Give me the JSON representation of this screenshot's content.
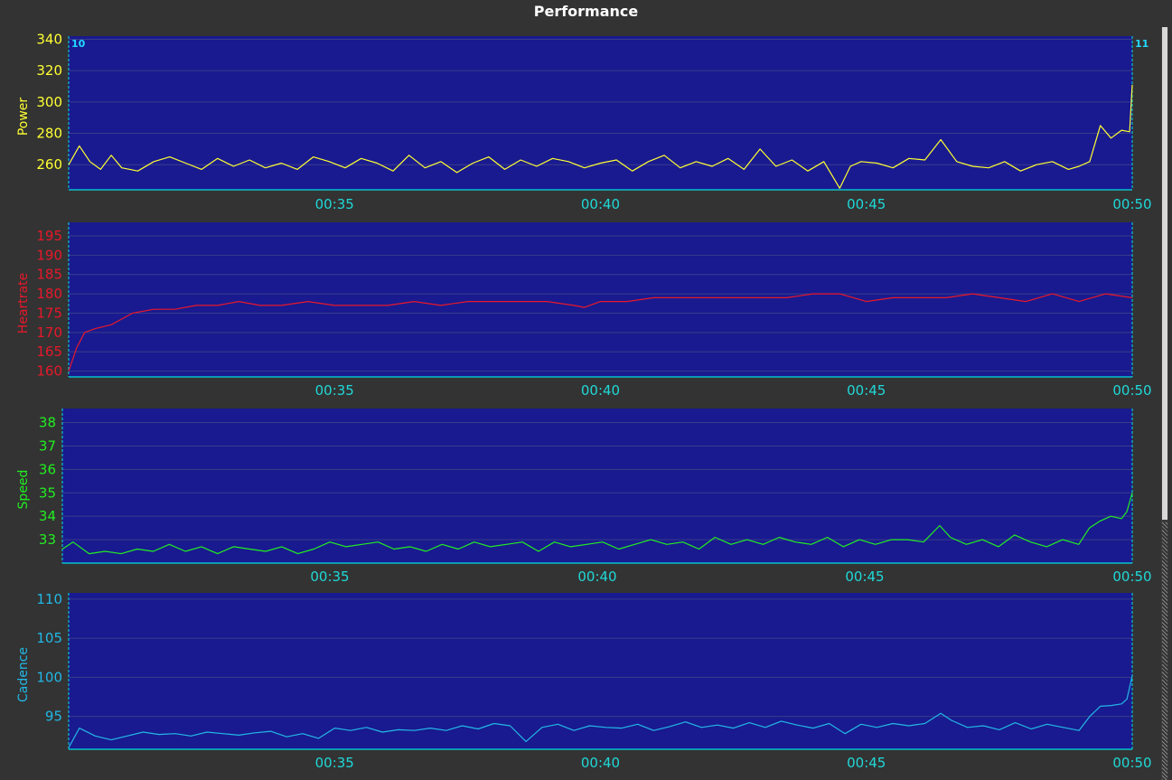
{
  "title": "Performance",
  "interval_markers": {
    "start": "10",
    "end": "11"
  },
  "colors": {
    "background": "#333333",
    "plot_bg": "#191a8f",
    "grid": "#3a3d8a",
    "axis": "#00e0e0",
    "tick_x": "#20d8d8",
    "power": "#ffff33",
    "heartrate": "#e8182a",
    "speed": "#22ee22",
    "cadence": "#22b8e6"
  },
  "chart_data": [
    {
      "type": "line",
      "ylabel": "Power",
      "ylim": [
        244,
        342
      ],
      "yticks": [
        340,
        320,
        300,
        280,
        260
      ],
      "xlim": [
        30.0,
        50.0
      ],
      "xticks": [
        "00:35",
        "00:40",
        "00:45",
        "00:50"
      ],
      "xtick_values": [
        35,
        40,
        45,
        50
      ],
      "grid": true,
      "color_key": "power",
      "series": [
        {
          "x": [
            30.0,
            30.2,
            30.4,
            30.6,
            30.8,
            31.0,
            31.3,
            31.6,
            31.9,
            32.2,
            32.5,
            32.8,
            33.1,
            33.4,
            33.7,
            34.0,
            34.3,
            34.6,
            34.9,
            35.2,
            35.5,
            35.8,
            36.1,
            36.4,
            36.7,
            37.0,
            37.3,
            37.6,
            37.9,
            38.2,
            38.5,
            38.8,
            39.1,
            39.4,
            39.7,
            40.0,
            40.3,
            40.6,
            40.9,
            41.2,
            41.5,
            41.8,
            42.1,
            42.4,
            42.7,
            43.0,
            43.3,
            43.6,
            43.9,
            44.2,
            44.5,
            44.7,
            44.9,
            45.2,
            45.5,
            45.8,
            46.1,
            46.4,
            46.7,
            47.0,
            47.3,
            47.6,
            47.9,
            48.2,
            48.5,
            48.8,
            49.0,
            49.2,
            49.4,
            49.6,
            49.8,
            49.95,
            50.0
          ],
          "y": [
            260,
            272,
            262,
            257,
            266,
            258,
            256,
            262,
            265,
            261,
            257,
            264,
            259,
            263,
            258,
            261,
            257,
            265,
            262,
            258,
            264,
            261,
            256,
            266,
            258,
            262,
            255,
            261,
            265,
            257,
            263,
            259,
            264,
            262,
            258,
            261,
            263,
            256,
            262,
            266,
            258,
            262,
            259,
            264,
            257,
            270,
            259,
            263,
            256,
            262,
            245,
            259,
            262,
            261,
            258,
            264,
            263,
            276,
            262,
            259,
            258,
            262,
            256,
            260,
            262,
            257,
            259,
            262,
            285,
            277,
            282,
            281,
            311
          ]
        }
      ]
    },
    {
      "type": "line",
      "ylabel": "Heartrate",
      "ylim": [
        158.5,
        198.5
      ],
      "yticks": [
        195,
        190,
        185,
        180,
        175,
        170,
        165,
        160
      ],
      "xlim": [
        30.0,
        50.0
      ],
      "xticks": [
        "00:35",
        "00:40",
        "00:45",
        "00:50"
      ],
      "xtick_values": [
        35,
        40,
        45,
        50
      ],
      "grid": true,
      "color_key": "heartrate",
      "series": [
        {
          "x": [
            30.0,
            30.15,
            30.3,
            30.5,
            30.8,
            31.2,
            31.6,
            32.0,
            32.4,
            32.8,
            33.2,
            33.6,
            34.0,
            34.5,
            35.0,
            35.5,
            36.0,
            36.5,
            37.0,
            37.5,
            38.0,
            38.5,
            39.0,
            39.5,
            39.7,
            40.0,
            40.5,
            41.0,
            41.5,
            42.0,
            42.5,
            43.0,
            43.5,
            44.0,
            44.5,
            45.0,
            45.5,
            46.0,
            46.5,
            47.0,
            47.5,
            48.0,
            48.5,
            49.0,
            49.5,
            50.0
          ],
          "y": [
            160,
            166,
            170,
            171,
            172,
            175,
            176,
            176,
            177,
            177,
            178,
            177,
            177,
            178,
            177,
            177,
            177,
            178,
            177,
            178,
            178,
            178,
            178,
            177,
            176.5,
            178,
            178,
            179,
            179,
            179,
            179,
            179,
            179,
            180,
            180,
            178,
            179,
            179,
            179,
            180,
            179,
            178,
            180,
            178,
            180,
            179
          ]
        }
      ]
    },
    {
      "type": "line",
      "ylabel": "Speed",
      "ylim": [
        32.0,
        38.6
      ],
      "yticks": [
        38,
        37,
        36,
        35,
        34,
        33
      ],
      "xlim": [
        30.0,
        50.0
      ],
      "xticks": [
        "00:35",
        "00:40",
        "00:45",
        "00:50"
      ],
      "xtick_values": [
        35,
        40,
        45,
        50
      ],
      "grid": true,
      "color_key": "speed",
      "series": [
        {
          "x": [
            30.0,
            30.2,
            30.5,
            30.8,
            31.1,
            31.4,
            31.7,
            32.0,
            32.3,
            32.6,
            32.9,
            33.2,
            33.5,
            33.8,
            34.1,
            34.4,
            34.7,
            35.0,
            35.3,
            35.6,
            35.9,
            36.2,
            36.5,
            36.8,
            37.1,
            37.4,
            37.7,
            38.0,
            38.3,
            38.6,
            38.9,
            39.2,
            39.5,
            39.8,
            40.1,
            40.4,
            40.7,
            41.0,
            41.3,
            41.6,
            41.9,
            42.2,
            42.5,
            42.8,
            43.1,
            43.4,
            43.7,
            44.0,
            44.3,
            44.6,
            44.9,
            45.2,
            45.5,
            45.8,
            46.1,
            46.4,
            46.6,
            46.9,
            47.2,
            47.5,
            47.8,
            48.1,
            48.4,
            48.7,
            49.0,
            49.2,
            49.4,
            49.6,
            49.8,
            49.9,
            50.0
          ],
          "y": [
            32.6,
            32.9,
            32.4,
            32.5,
            32.4,
            32.6,
            32.5,
            32.8,
            32.5,
            32.7,
            32.4,
            32.7,
            32.6,
            32.5,
            32.7,
            32.4,
            32.6,
            32.9,
            32.7,
            32.8,
            32.9,
            32.6,
            32.7,
            32.5,
            32.8,
            32.6,
            32.9,
            32.7,
            32.8,
            32.9,
            32.5,
            32.9,
            32.7,
            32.8,
            32.9,
            32.6,
            32.8,
            33.0,
            32.8,
            32.9,
            32.6,
            33.1,
            32.8,
            33.0,
            32.8,
            33.1,
            32.9,
            32.8,
            33.1,
            32.7,
            33.0,
            32.8,
            33.0,
            33.0,
            32.9,
            33.6,
            33.1,
            32.8,
            33.0,
            32.7,
            33.2,
            32.9,
            32.7,
            33.0,
            32.8,
            33.5,
            33.8,
            34.0,
            33.9,
            34.2,
            35.0
          ]
        }
      ]
    },
    {
      "type": "line",
      "ylabel": "Cadence",
      "ylim": [
        90.8,
        110.8
      ],
      "yticks": [
        110,
        105,
        100,
        95
      ],
      "xlim": [
        30.0,
        50.0
      ],
      "xticks": [
        "00:35",
        "00:40",
        "00:45",
        "00:50"
      ],
      "xtick_values": [
        35,
        40,
        45,
        50
      ],
      "grid": true,
      "color_key": "cadence",
      "series": [
        {
          "x": [
            30.0,
            30.2,
            30.5,
            30.8,
            31.1,
            31.4,
            31.7,
            32.0,
            32.3,
            32.6,
            32.9,
            33.2,
            33.5,
            33.8,
            34.1,
            34.4,
            34.7,
            35.0,
            35.3,
            35.6,
            35.9,
            36.2,
            36.5,
            36.8,
            37.1,
            37.4,
            37.7,
            38.0,
            38.3,
            38.6,
            38.9,
            39.2,
            39.5,
            39.8,
            40.1,
            40.4,
            40.7,
            41.0,
            41.3,
            41.6,
            41.9,
            42.2,
            42.5,
            42.8,
            43.1,
            43.4,
            43.7,
            44.0,
            44.3,
            44.6,
            44.9,
            45.2,
            45.5,
            45.8,
            46.1,
            46.4,
            46.6,
            46.9,
            47.2,
            47.5,
            47.8,
            48.1,
            48.4,
            48.7,
            49.0,
            49.2,
            49.4,
            49.6,
            49.8,
            49.9,
            50.0
          ],
          "y": [
            91,
            93.5,
            92.5,
            92,
            92.5,
            93,
            92.7,
            92.8,
            92.5,
            93,
            92.8,
            92.6,
            92.9,
            93.1,
            92.4,
            92.8,
            92.2,
            93.5,
            93.2,
            93.6,
            93,
            93.3,
            93.2,
            93.5,
            93.2,
            93.8,
            93.4,
            94.1,
            93.8,
            91.8,
            93.6,
            94.0,
            93.2,
            93.8,
            93.6,
            93.5,
            94.0,
            93.2,
            93.7,
            94.3,
            93.6,
            93.9,
            93.5,
            94.2,
            93.6,
            94.4,
            93.9,
            93.5,
            94.1,
            92.8,
            94.0,
            93.6,
            94.1,
            93.8,
            94.1,
            95.4,
            94.5,
            93.6,
            93.8,
            93.3,
            94.2,
            93.4,
            94.0,
            93.6,
            93.2,
            95.0,
            96.3,
            96.4,
            96.6,
            97.2,
            100.2
          ]
        }
      ]
    }
  ]
}
